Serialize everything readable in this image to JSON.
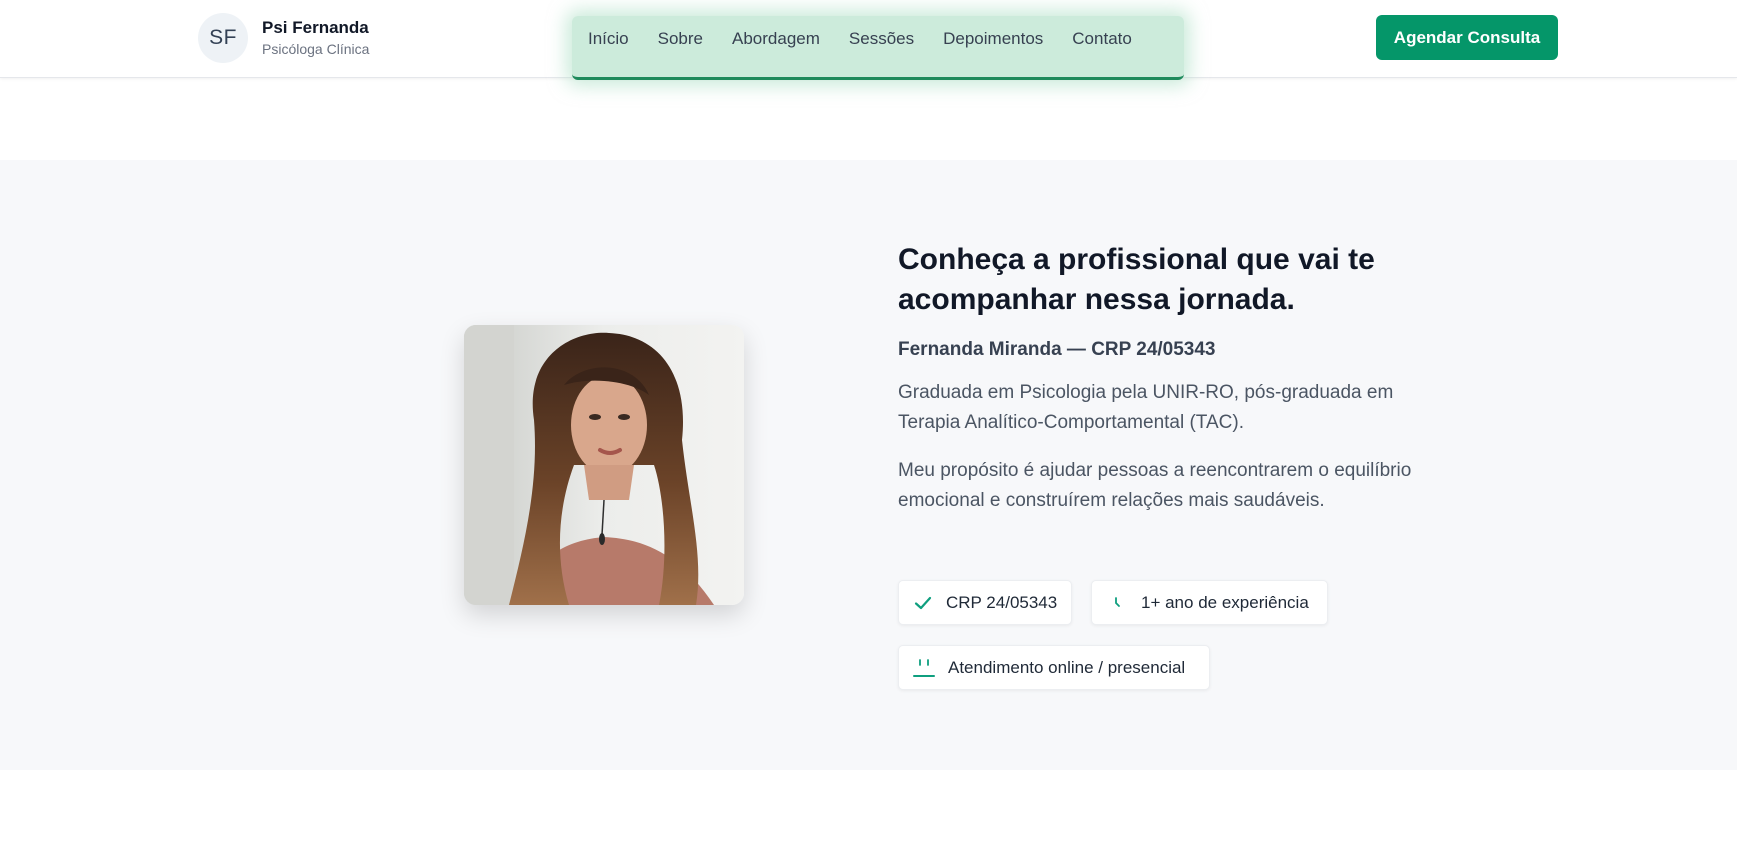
{
  "header": {
    "avatar_initials": "SF",
    "brand_name": "Psi Fernanda",
    "brand_subtitle": "Psicóloga Clínica",
    "nav": [
      "Início",
      "Sobre",
      "Abordagem",
      "Sessões",
      "Depoimentos",
      "Contato"
    ],
    "cta_label": "Agendar Consulta"
  },
  "about": {
    "photo_alt": "Fernanda Miranda",
    "heading": "Conheça a profissional que vai te acompanhar nessa jornada.",
    "name_crp": "Fernanda Miranda — CRP 24/05343",
    "paragraph_1": "Graduada em Psicologia pela UNIR-RO, pós-graduada em Terapia Analítico-Comportamental (TAC).",
    "paragraph_2": "Meu propósito é ajudar pessoas a reencontrarem o equilíbrio emocional e construírem relações mais saudáveis.",
    "badges": [
      {
        "icon": "check-icon",
        "label": "CRP 24/05343"
      },
      {
        "icon": "clock-icon",
        "label": "1+ ano de experiência"
      },
      {
        "icon": "laptop-icon",
        "label": "Atendimento online / presencial"
      }
    ]
  },
  "colors": {
    "accent": "#059669",
    "section_bg": "#f7f8fa",
    "nav_highlight": "#a3dabe"
  }
}
